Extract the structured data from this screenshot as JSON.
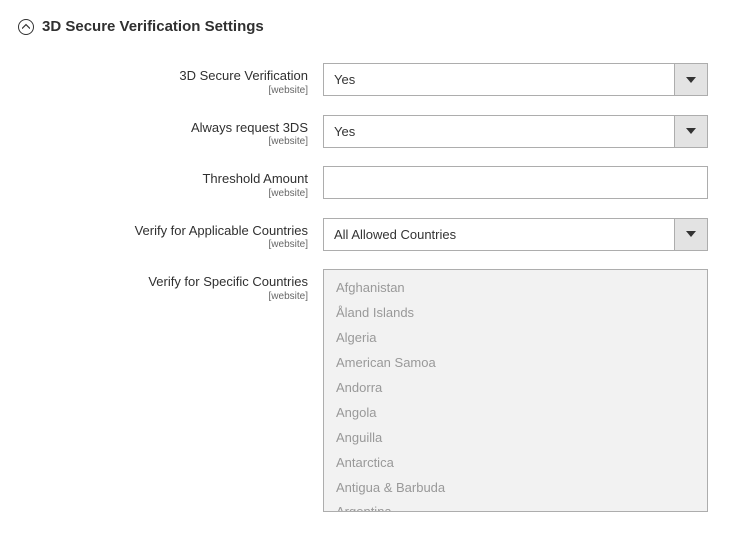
{
  "section": {
    "title": "3D Secure Verification Settings"
  },
  "fields": {
    "verification": {
      "label": "3D Secure Verification",
      "scope": "[website]",
      "value": "Yes"
    },
    "always_request": {
      "label": "Always request 3DS",
      "scope": "[website]",
      "value": "Yes"
    },
    "threshold": {
      "label": "Threshold Amount",
      "scope": "[website]",
      "value": ""
    },
    "applicable": {
      "label": "Verify for Applicable Countries",
      "scope": "[website]",
      "value": "All Allowed Countries"
    },
    "specific": {
      "label": "Verify for Specific Countries",
      "scope": "[website]",
      "options": [
        "Afghanistan",
        "Åland Islands",
        "Algeria",
        "American Samoa",
        "Andorra",
        "Angola",
        "Anguilla",
        "Antarctica",
        "Antigua & Barbuda",
        "Argentina"
      ]
    }
  }
}
